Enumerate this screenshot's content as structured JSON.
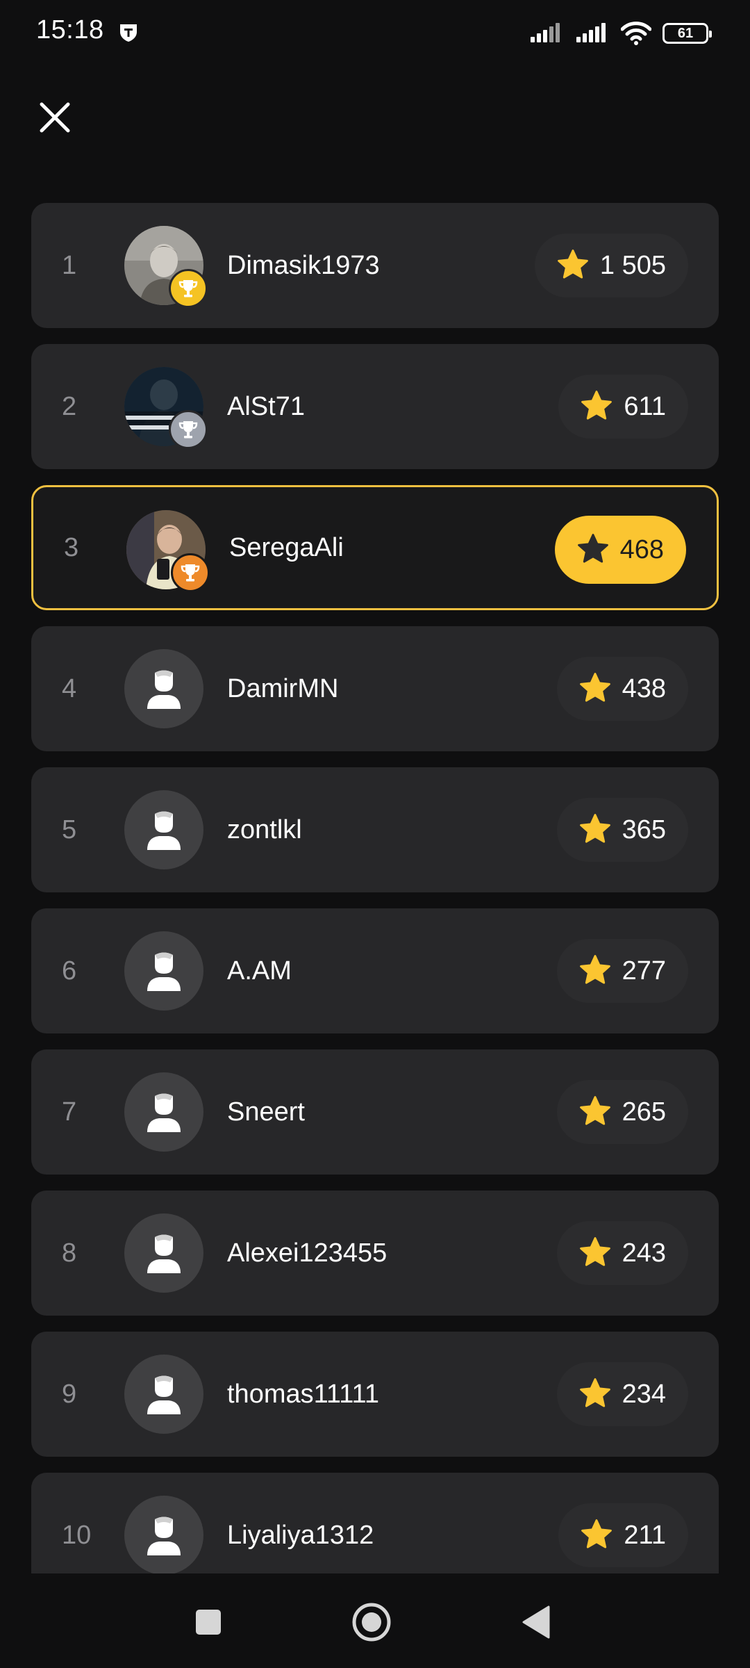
{
  "status_bar": {
    "time": "15:18",
    "battery_level": "61"
  },
  "header": {
    "close_icon": "close-icon"
  },
  "leaderboard": {
    "entries": [
      {
        "rank": "1",
        "name": "Dimasik1973",
        "score": "1 505",
        "trophy": "gold",
        "avatar": "photo"
      },
      {
        "rank": "2",
        "name": "AlSt71",
        "score": "611",
        "trophy": "silver",
        "avatar": "photo"
      },
      {
        "rank": "3",
        "name": "SeregaAli",
        "score": "468",
        "trophy": "bronze",
        "avatar": "photo",
        "current_user": true
      },
      {
        "rank": "4",
        "name": "DamirMN",
        "score": "438",
        "avatar": "default"
      },
      {
        "rank": "5",
        "name": "zontlkl",
        "score": "365",
        "avatar": "default"
      },
      {
        "rank": "6",
        "name": "A.AM",
        "score": "277",
        "avatar": "default"
      },
      {
        "rank": "7",
        "name": "Sneert",
        "score": "265",
        "avatar": "default"
      },
      {
        "rank": "8",
        "name": "Alexei123455",
        "score": "243",
        "avatar": "default"
      },
      {
        "rank": "9",
        "name": "thomas11111",
        "score": "234",
        "avatar": "default"
      },
      {
        "rank": "10",
        "name": "Liyaliya1312",
        "score": "211",
        "avatar": "default"
      }
    ]
  },
  "colors": {
    "background": "#0f0f10",
    "row": "#272729",
    "accent": "#fbc531",
    "gold": "#f5c323",
    "silver": "#9ea3ad",
    "bronze": "#ee8a2a"
  },
  "nav": {
    "icons": [
      "recents-square-icon",
      "home-circle-icon",
      "back-triangle-icon"
    ]
  }
}
